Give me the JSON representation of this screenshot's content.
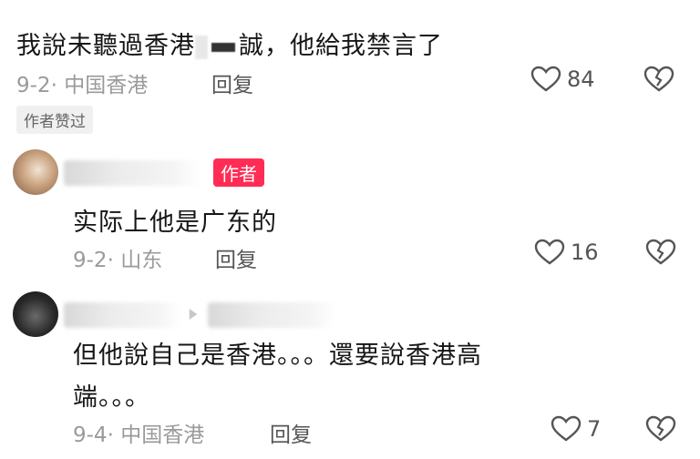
{
  "comment1": {
    "text_before": "我說未聽過香港",
    "text_after": "誠，他給我禁言了",
    "date": "9-2",
    "location": "中国香港",
    "reply_label": "回复",
    "likes": "84",
    "liked_by_author": "作者赞过"
  },
  "comment2": {
    "author_tag": "作者",
    "text": "实际上他是广东的",
    "date": "9-2",
    "location": "山东",
    "reply_label": "回复",
    "likes": "16"
  },
  "comment3": {
    "text_line1": "但他說自己是香港。。。還要說香港高",
    "text_line2": "端。。。",
    "date": "9-4",
    "location": "中国香港",
    "reply_label": "回复",
    "likes": "7"
  },
  "icons": {
    "like": "heart-outline-icon",
    "dislike": "broken-heart-icon",
    "reply_arrow": "reply-arrow-icon"
  },
  "colors": {
    "author_tag": "#ff2c55",
    "meta_text": "#9a9a9a"
  }
}
